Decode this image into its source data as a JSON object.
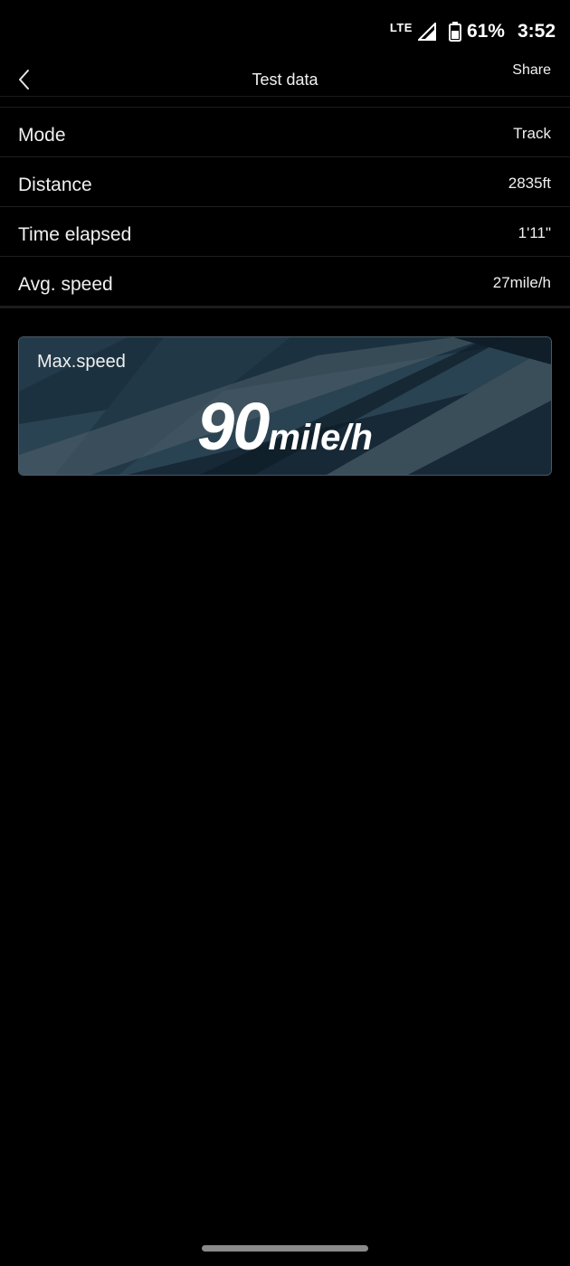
{
  "status_bar": {
    "network": "LTE",
    "battery_percent": "61%",
    "time": "3:52",
    "icons": [
      "lte-icon",
      "signal-icon",
      "battery-icon"
    ]
  },
  "header": {
    "back_icon": "chevron-left-icon",
    "title": "Test data",
    "share_label": "Share"
  },
  "info_rows": [
    {
      "label": "Mode",
      "value": "Track"
    },
    {
      "label": "Distance",
      "value": "2835ft"
    },
    {
      "label": "Time elapsed",
      "value": "1'11\""
    },
    {
      "label": "Avg. speed",
      "value": "27mile/h"
    }
  ],
  "max_speed": {
    "label": "Max.speed",
    "value": "90",
    "unit": "mile/h"
  },
  "colors": {
    "background": "#000000",
    "text": "#ffffff",
    "card_background": "#1d3342",
    "divider": "#1e1e1e"
  }
}
